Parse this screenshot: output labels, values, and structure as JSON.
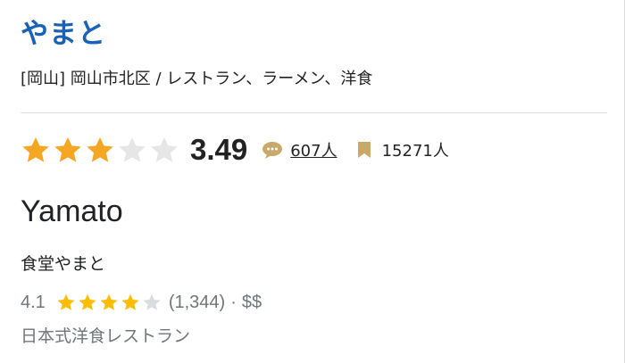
{
  "restaurant": {
    "title": "やまと",
    "area_line": "[岡山] 岡山市北区 / レストラン、ラーメン、洋食"
  },
  "tabelog": {
    "score": "3.49",
    "review_count": "607人",
    "bookmark_count": "15271人",
    "stars_filled": 3,
    "stars_total": 5,
    "star_color": "#f5a623",
    "star_empty_color": "#e6e6e6"
  },
  "google": {
    "name": "Yamato",
    "subname": "食堂やまと",
    "score": "4.1",
    "rating_value": 4.1,
    "review_count": "(1,344)",
    "separator": "·",
    "price": "$$",
    "category": "日本式洋食レストラン",
    "star_color": "#fbbc04",
    "star_empty_color": "#dadce0"
  },
  "colors": {
    "title": "#1a62b5",
    "text": "#222222",
    "muted": "#70757a",
    "comment_icon": "#c8a96a",
    "bookmark_icon": "#c8a96a"
  }
}
